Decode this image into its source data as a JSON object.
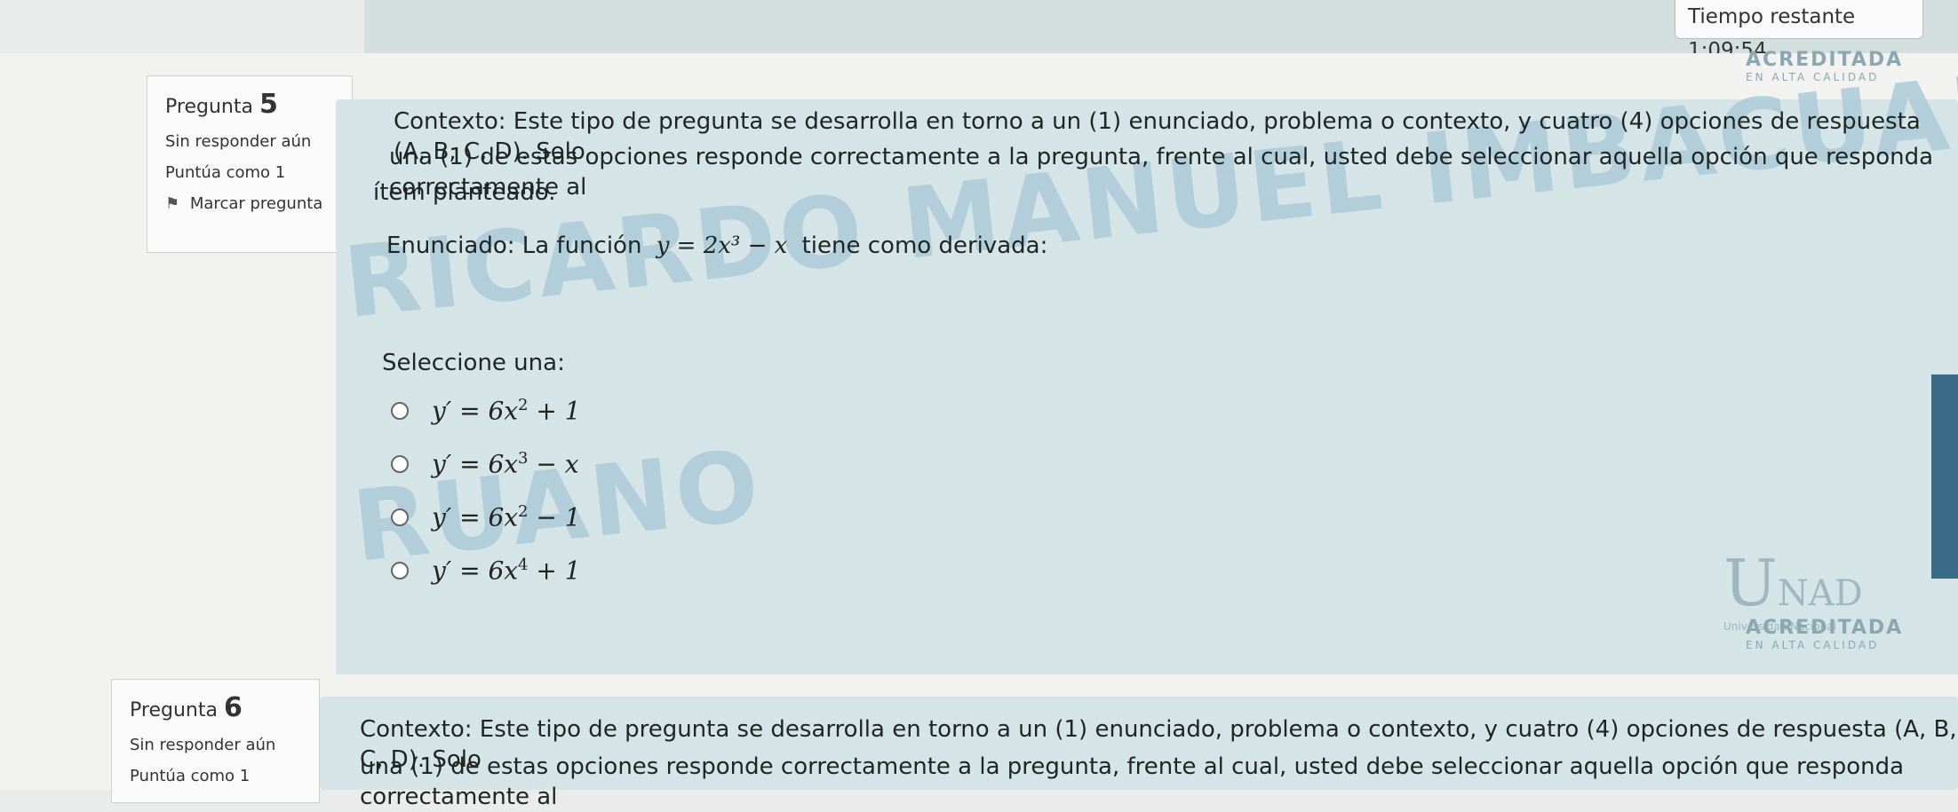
{
  "timer": {
    "label": "Tiempo restante 1:09:54"
  },
  "question5": {
    "label": "Pregunta",
    "number": "5",
    "status": "Sin responder aún",
    "points": "Puntúa como 1",
    "flag": "Marcar pregunta",
    "context_lines": [
      "Contexto: Este tipo de pregunta se desarrolla en torno a un (1) enunciado, problema o contexto, y cuatro (4) opciones de respuesta (A, B, C, D). Solo",
      "una (1) de estas opciones responde correctamente a la pregunta, frente al cual, usted debe seleccionar aquella opción que responda correctamente al",
      "ítem planteado."
    ],
    "statement_prefix": "Enunciado: La función",
    "statement_math": "y = 2x³ − x",
    "statement_suffix": "tiene como derivada:",
    "select_label": "Seleccione una:",
    "options": [
      {
        "lhs": "y′ = 6x",
        "exp": "2",
        "rhs": " + 1"
      },
      {
        "lhs": "y′ = 6x",
        "exp": "3",
        "rhs": " − x"
      },
      {
        "lhs": "y′ = 6x",
        "exp": "2",
        "rhs": " − 1"
      },
      {
        "lhs": "y′ = 6x",
        "exp": "4",
        "rhs": " + 1"
      }
    ]
  },
  "question6": {
    "label": "Pregunta",
    "number": "6",
    "status": "Sin responder aún",
    "points": "Puntúa como 1",
    "context_lines": [
      "Contexto: Este tipo de pregunta se desarrolla en torno a un (1) enunciado, problema o contexto, y cuatro (4) opciones de respuesta (A, B, C, D). Solo",
      "una (1) de estas opciones responde correctamente a la pregunta, frente al cual, usted debe seleccionar aquella opción que responda correctamente al"
    ]
  },
  "watermark": {
    "line1": "RICARDO MANUEL IMBACUAN",
    "line2": "RUANO"
  },
  "badges": {
    "acreditada": "ACREDITADA",
    "alta_calidad": "EN ALTA CALIDAD",
    "unad_u": "U",
    "unad_rest": "NAD",
    "unad_sub": "Universidad Nacional"
  },
  "colors": {
    "panel": "#d5e4e6",
    "accent": "#3a6b86",
    "watermark": "#a9c9d8"
  }
}
